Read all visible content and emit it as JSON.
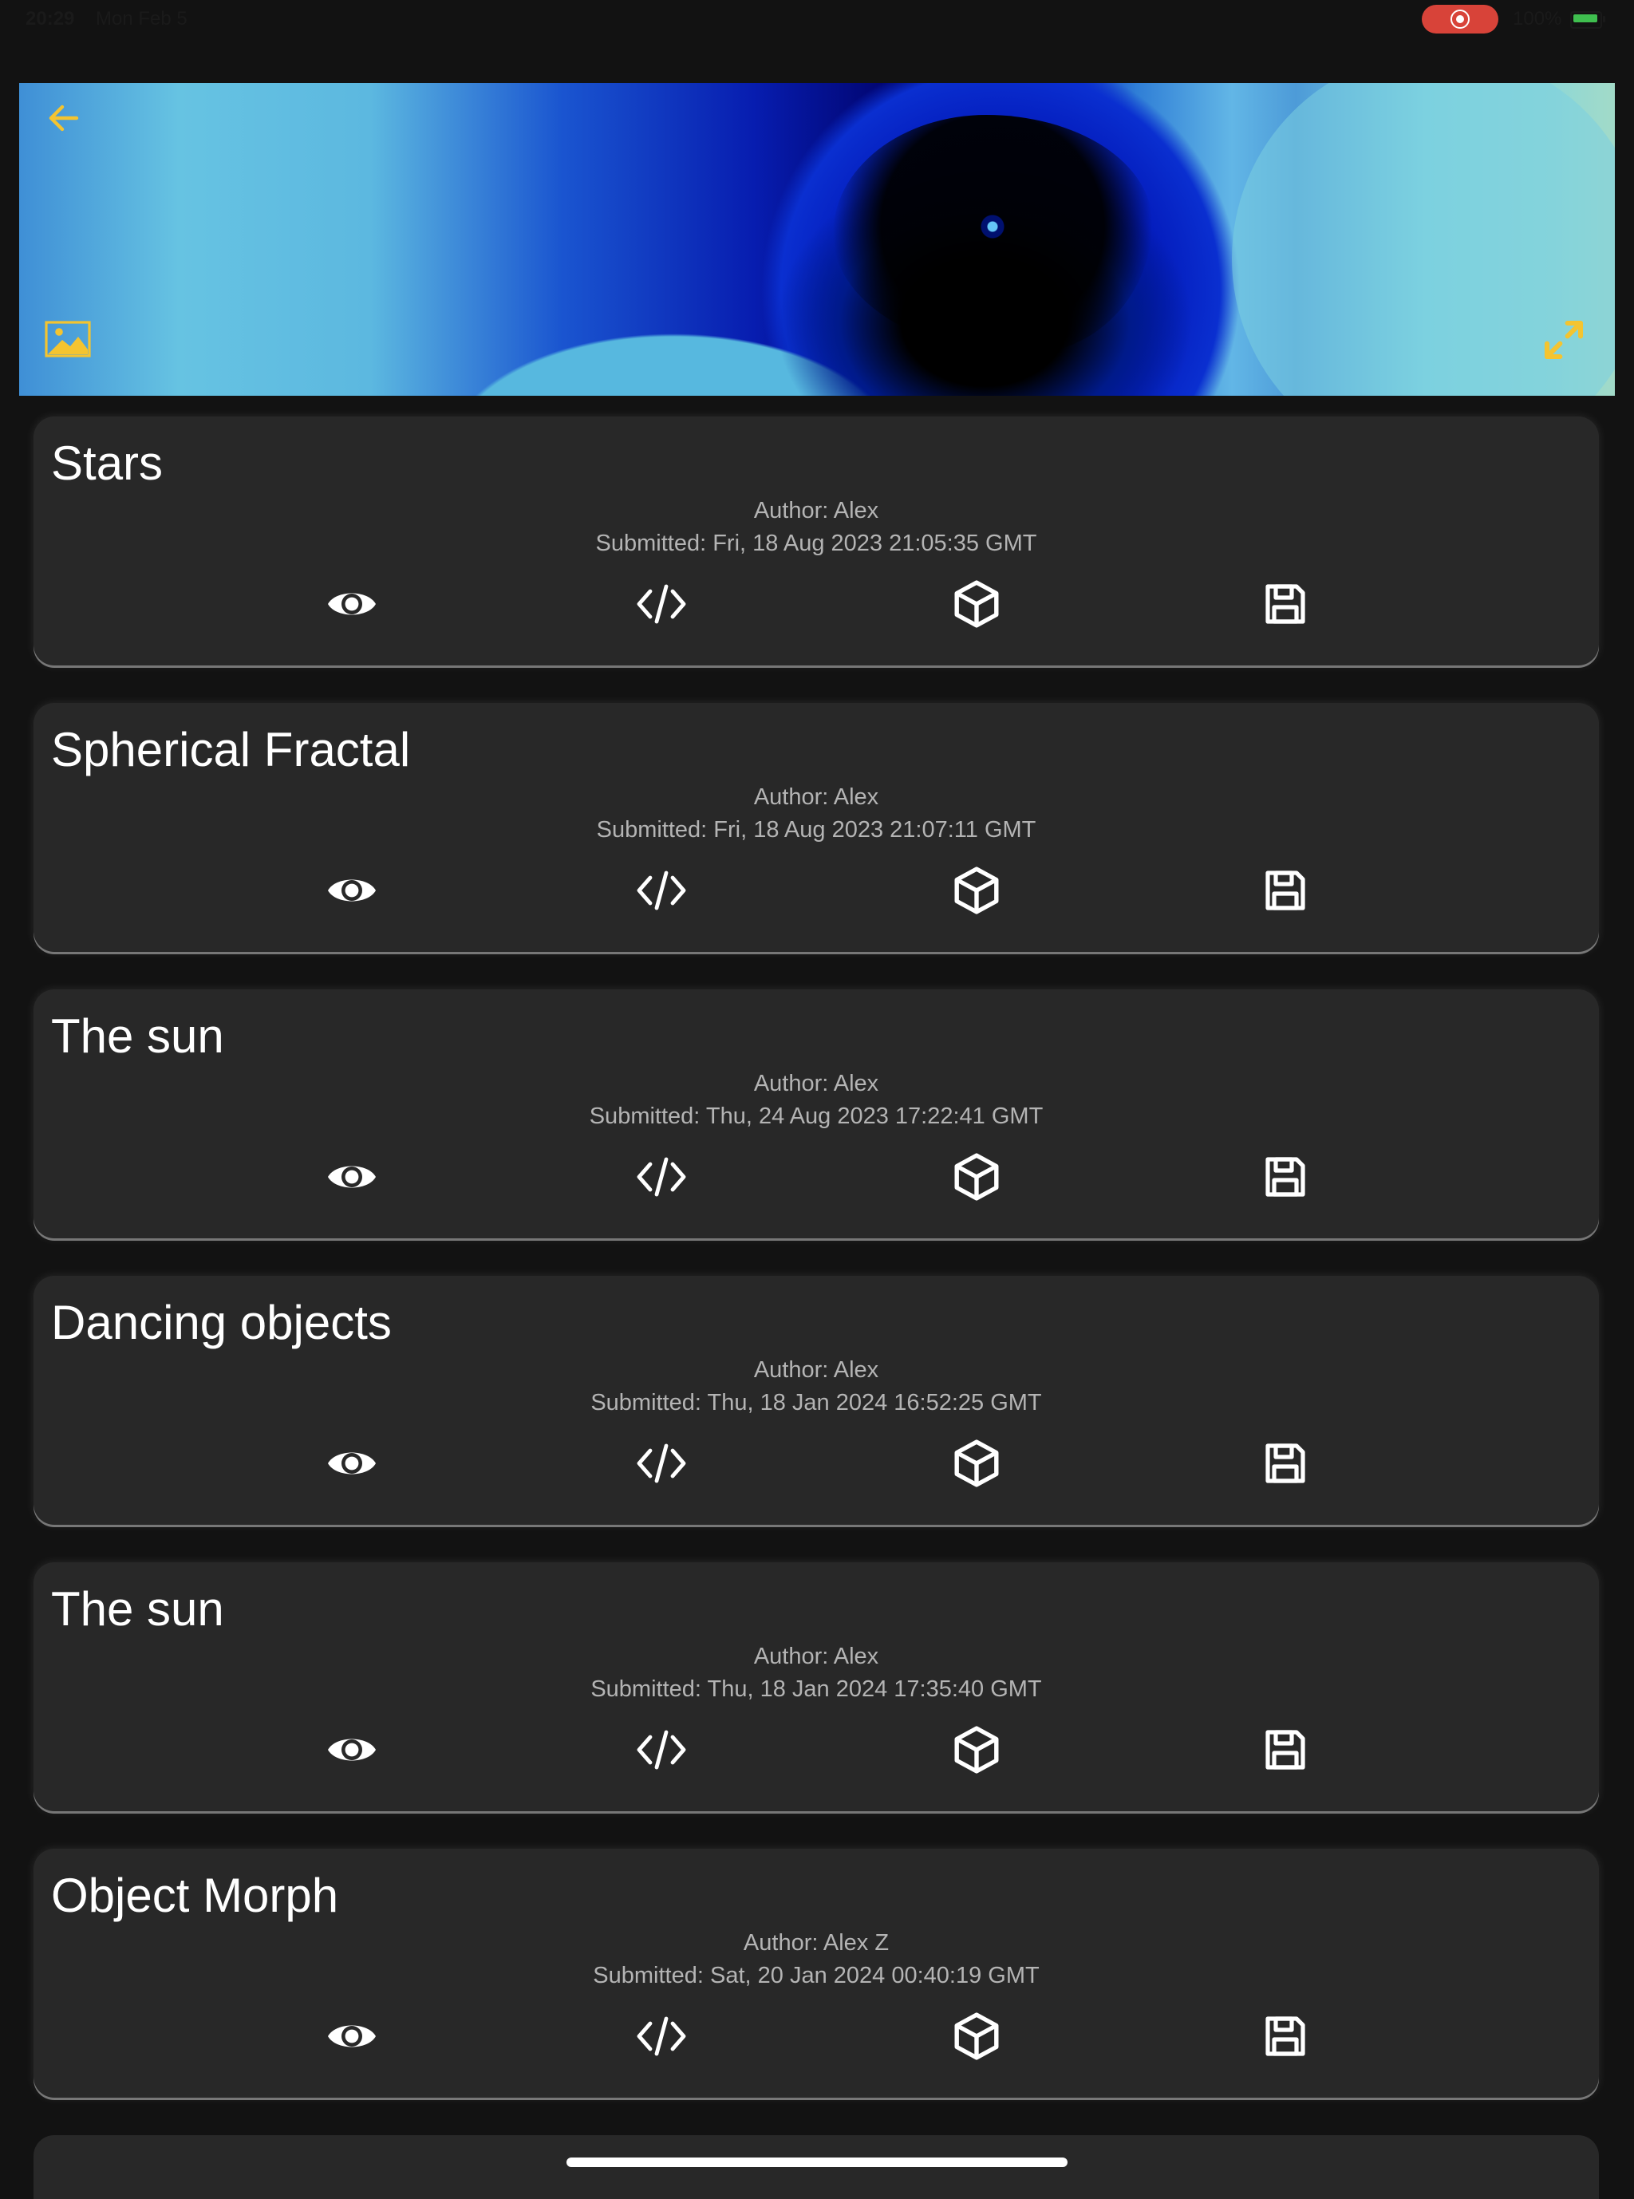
{
  "status_bar": {
    "time": "20:29",
    "date": "Mon Feb 5",
    "battery": "100%"
  },
  "header": {
    "back_icon": "arrow-left-icon",
    "image_icon": "image-icon",
    "expand_icon": "expand-arrows-icon",
    "accent_color": "#f4c430"
  },
  "cards": [
    {
      "title": "Stars",
      "author": "Author: Alex",
      "submitted": "Submitted: Fri, 18 Aug 2023 21:05:35 GMT"
    },
    {
      "title": "Spherical Fractal",
      "author": "Author: Alex",
      "submitted": "Submitted: Fri, 18 Aug 2023 21:07:11 GMT"
    },
    {
      "title": "The sun",
      "author": "Author: Alex",
      "submitted": "Submitted: Thu, 24 Aug 2023 17:22:41 GMT"
    },
    {
      "title": "Dancing objects",
      "author": "Author: Alex",
      "submitted": "Submitted: Thu, 18 Jan 2024 16:52:25 GMT"
    },
    {
      "title": "The sun",
      "author": "Author: Alex",
      "submitted": "Submitted: Thu, 18 Jan 2024 17:35:40 GMT"
    },
    {
      "title": "Object Morph",
      "author": "Author: Alex Z",
      "submitted": "Submitted: Sat, 20 Jan 2024 00:40:19 GMT"
    }
  ],
  "card_actions": [
    "eye-icon",
    "code-icon",
    "cube-icon",
    "save-icon"
  ],
  "colors": {
    "background": "#121212",
    "card": "#282828",
    "meta_text": "#b4b4b4",
    "record_pill": "#d84339"
  }
}
